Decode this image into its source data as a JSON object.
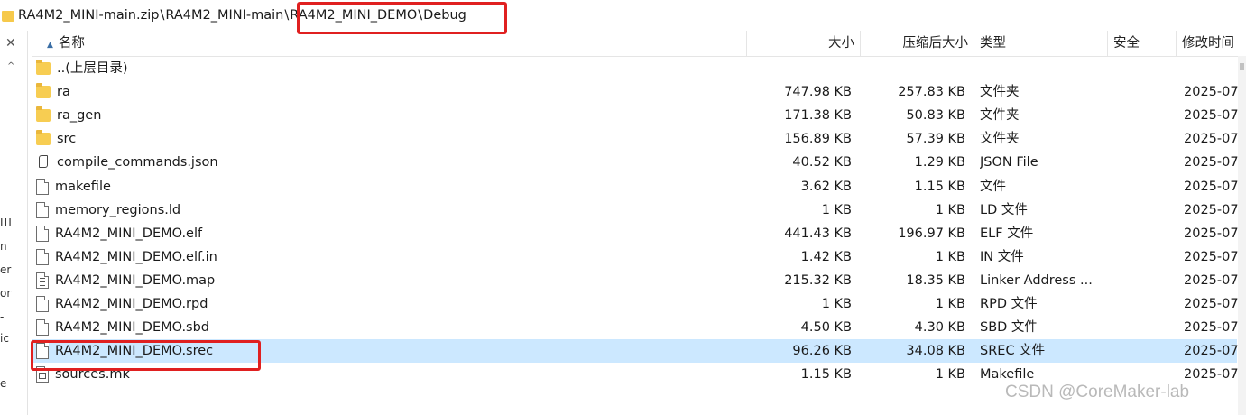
{
  "address_bar": {
    "segments": [
      "RA4M2_MINI-main.zip",
      "RA4M2_MINI-main",
      "RA4M2_MINI_DEMO",
      "Debug"
    ],
    "separator": "\\"
  },
  "sidebar": {
    "close_glyph": "✕",
    "up_glyph": "^",
    "fragments": [
      "Ш",
      "n",
      "er",
      "or",
      "-",
      "ic",
      "e"
    ]
  },
  "columns": {
    "name": "名称",
    "size": "大小",
    "compressed": "压缩后大小",
    "type": "类型",
    "security": "安全",
    "modified": "修改时间"
  },
  "files": [
    {
      "icon": "folder",
      "name": "..(上层目录)",
      "size": "",
      "compressed": "",
      "type": "",
      "date": ""
    },
    {
      "icon": "folder",
      "name": "ra",
      "size": "747.98 KB",
      "compressed": "257.83 KB",
      "type": "文件夹",
      "date": "2025-07"
    },
    {
      "icon": "folder",
      "name": "ra_gen",
      "size": "171.38 KB",
      "compressed": "50.83 KB",
      "type": "文件夹",
      "date": "2025-07"
    },
    {
      "icon": "folder",
      "name": "src",
      "size": "156.89 KB",
      "compressed": "57.39 KB",
      "type": "文件夹",
      "date": "2025-07"
    },
    {
      "icon": "json",
      "name": "compile_commands.json",
      "size": "40.52 KB",
      "compressed": "1.29 KB",
      "type": "JSON File",
      "date": "2025-07"
    },
    {
      "icon": "file",
      "name": "makefile",
      "size": "3.62 KB",
      "compressed": "1.15 KB",
      "type": "文件",
      "date": "2025-07"
    },
    {
      "icon": "file",
      "name": "memory_regions.ld",
      "size": "1 KB",
      "compressed": "1 KB",
      "type": "LD 文件",
      "date": "2025-07"
    },
    {
      "icon": "file",
      "name": "RA4M2_MINI_DEMO.elf",
      "size": "441.43 KB",
      "compressed": "196.97 KB",
      "type": "ELF 文件",
      "date": "2025-07"
    },
    {
      "icon": "file",
      "name": "RA4M2_MINI_DEMO.elf.in",
      "size": "1.42 KB",
      "compressed": "1 KB",
      "type": "IN 文件",
      "date": "2025-07"
    },
    {
      "icon": "doc",
      "name": "RA4M2_MINI_DEMO.map",
      "size": "215.32 KB",
      "compressed": "18.35 KB",
      "type": "Linker Address ...",
      "date": "2025-07"
    },
    {
      "icon": "file",
      "name": "RA4M2_MINI_DEMO.rpd",
      "size": "1 KB",
      "compressed": "1 KB",
      "type": "RPD 文件",
      "date": "2025-07"
    },
    {
      "icon": "file",
      "name": "RA4M2_MINI_DEMO.sbd",
      "size": "4.50 KB",
      "compressed": "4.30 KB",
      "type": "SBD 文件",
      "date": "2025-07"
    },
    {
      "icon": "file",
      "name": "RA4M2_MINI_DEMO.srec",
      "size": "96.26 KB",
      "compressed": "34.08 KB",
      "type": "SREC 文件",
      "date": "2025-07",
      "selected": true
    },
    {
      "icon": "mk",
      "name": "sources.mk",
      "size": "1.15 KB",
      "compressed": "1 KB",
      "type": "Makefile",
      "date": "2025-07"
    }
  ],
  "watermark": "CSDN @CoreMaker-lab",
  "colors": {
    "selection": "#cce8ff",
    "highlight_box": "#e02020",
    "folder": "#f7cd52"
  }
}
